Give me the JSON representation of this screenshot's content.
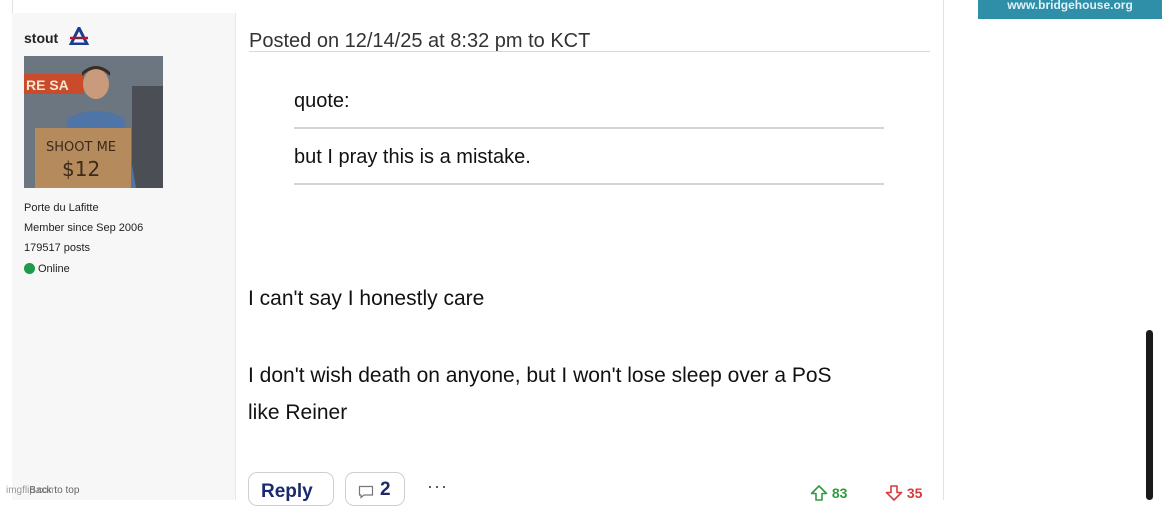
{
  "post": {
    "author": {
      "username": "stout",
      "team_logo": "arizona-a-logo",
      "location": "Porte du Lafitte",
      "member_since": "Member since Sep 2006",
      "posts": "179517 posts",
      "status": "Online"
    },
    "avatar": {
      "banner_text": "RE SA",
      "sign_line1": "SHOOT ME",
      "sign_line2": "$12"
    },
    "header": "Posted on 12/14/25 at 8:32 pm to KCT",
    "quote": {
      "label": "quote:",
      "text": "but I pray this is a mistake."
    },
    "body": [
      "I can't say I honestly care",
      "I don't wish death on anyone, but I won't lose sleep over a PoS",
      "like Reiner"
    ],
    "actions": {
      "reply_label": "Reply",
      "comment_count": "2",
      "more_label": "···"
    },
    "votes": {
      "up": "83",
      "down": "35",
      "up_color": "#2e9b3e",
      "down_color": "#d93a3a"
    }
  },
  "footer": {
    "back_to_top": "Back to top",
    "imgflip_watermark": "imgflip.com"
  },
  "ad": {
    "text": "www.bridgehouse.org"
  },
  "colors": {
    "accent_blue": "#1a2a6c",
    "online_green": "#1d9a4a",
    "sidebar_bg": "#f7f7f7"
  }
}
